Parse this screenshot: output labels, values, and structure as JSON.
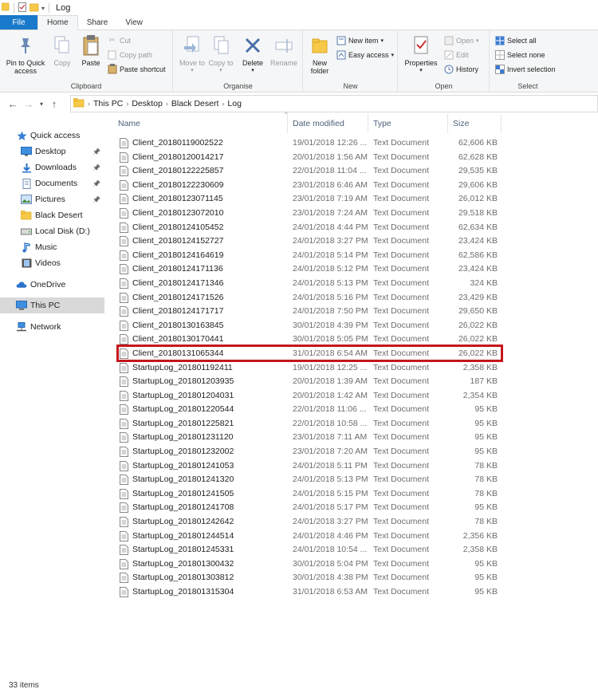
{
  "window": {
    "title": "Log"
  },
  "tabs": [
    "File",
    "Home",
    "Share",
    "View"
  ],
  "ribbon": {
    "clipboard": {
      "label": "Clipboard",
      "pin": "Pin to Quick access",
      "copy": "Copy",
      "paste": "Paste",
      "cut": "Cut",
      "copy_path": "Copy path",
      "paste_shortcut": "Paste shortcut"
    },
    "organise": {
      "label": "Organise",
      "move_to": "Move to",
      "copy_to": "Copy to",
      "delete": "Delete",
      "rename": "Rename"
    },
    "new": {
      "label": "New",
      "new_folder": "New folder",
      "new_item": "New item",
      "easy_access": "Easy access"
    },
    "open": {
      "label": "Open",
      "properties": "Properties",
      "open": "Open",
      "edit": "Edit",
      "history": "History"
    },
    "select": {
      "label": "Select",
      "select_all": "Select all",
      "select_none": "Select none",
      "invert": "Invert selection"
    }
  },
  "breadcrumb": [
    "This PC",
    "Desktop",
    "Black Desert",
    "Log"
  ],
  "nav": [
    {
      "label": "Quick access",
      "icon": "star-icon",
      "pinned": false,
      "selected": false
    },
    {
      "label": "Desktop",
      "icon": "desktop-icon",
      "pinned": true,
      "selected": false
    },
    {
      "label": "Downloads",
      "icon": "download-icon",
      "pinned": true,
      "selected": false
    },
    {
      "label": "Documents",
      "icon": "documents-icon",
      "pinned": true,
      "selected": false
    },
    {
      "label": "Pictures",
      "icon": "pictures-icon",
      "pinned": true,
      "selected": false
    },
    {
      "label": "Black Desert",
      "icon": "folder-icon",
      "pinned": false,
      "selected": false
    },
    {
      "label": "Local Disk (D:)",
      "icon": "drive-icon",
      "pinned": false,
      "selected": false
    },
    {
      "label": "Music",
      "icon": "music-icon",
      "pinned": false,
      "selected": false
    },
    {
      "label": "Videos",
      "icon": "videos-icon",
      "pinned": false,
      "selected": false
    },
    {
      "label": "OneDrive",
      "icon": "cloud-icon",
      "pinned": false,
      "selected": false
    },
    {
      "label": "This PC",
      "icon": "computer-icon",
      "pinned": false,
      "selected": true
    },
    {
      "label": "Network",
      "icon": "network-icon",
      "pinned": false,
      "selected": false
    }
  ],
  "columns": {
    "name": "Name",
    "date": "Date modified",
    "type": "Type",
    "size": "Size"
  },
  "files": [
    [
      "Client_20180119002522",
      "19/01/2018 12:26 ...",
      "Text Document",
      "62,606 KB"
    ],
    [
      "Client_20180120014217",
      "20/01/2018 1:56 AM",
      "Text Document",
      "62,628 KB"
    ],
    [
      "Client_20180122225857",
      "22/01/2018 11:04 ...",
      "Text Document",
      "29,535 KB"
    ],
    [
      "Client_20180122230609",
      "23/01/2018 6:46 AM",
      "Text Document",
      "29,606 KB"
    ],
    [
      "Client_20180123071145",
      "23/01/2018 7:19 AM",
      "Text Document",
      "26,012 KB"
    ],
    [
      "Client_20180123072010",
      "23/01/2018 7:24 AM",
      "Text Document",
      "29,518 KB"
    ],
    [
      "Client_20180124105452",
      "24/01/2018 4:44 PM",
      "Text Document",
      "62,634 KB"
    ],
    [
      "Client_20180124152727",
      "24/01/2018 3:27 PM",
      "Text Document",
      "23,424 KB"
    ],
    [
      "Client_20180124164619",
      "24/01/2018 5:14 PM",
      "Text Document",
      "62,586 KB"
    ],
    [
      "Client_20180124171136",
      "24/01/2018 5:12 PM",
      "Text Document",
      "23,424 KB"
    ],
    [
      "Client_20180124171346",
      "24/01/2018 5:13 PM",
      "Text Document",
      "324 KB"
    ],
    [
      "Client_20180124171526",
      "24/01/2018 5:16 PM",
      "Text Document",
      "23,429 KB"
    ],
    [
      "Client_20180124171717",
      "24/01/2018 7:50 PM",
      "Text Document",
      "29,650 KB"
    ],
    [
      "Client_20180130163845",
      "30/01/2018 4:39 PM",
      "Text Document",
      "26,022 KB"
    ],
    [
      "Client_20180130170441",
      "30/01/2018 5:05 PM",
      "Text Document",
      "26,022 KB"
    ],
    [
      "Client_20180131065344",
      "31/01/2018 6:54 AM",
      "Text Document",
      "26,022 KB"
    ],
    [
      "StartupLog_201801192411",
      "19/01/2018 12:25 ...",
      "Text Document",
      "2,358 KB"
    ],
    [
      "StartupLog_201801203935",
      "20/01/2018 1:39 AM",
      "Text Document",
      "187 KB"
    ],
    [
      "StartupLog_201801204031",
      "20/01/2018 1:42 AM",
      "Text Document",
      "2,354 KB"
    ],
    [
      "StartupLog_201801220544",
      "22/01/2018 11:06 ...",
      "Text Document",
      "95 KB"
    ],
    [
      "StartupLog_201801225821",
      "22/01/2018 10:58 ...",
      "Text Document",
      "95 KB"
    ],
    [
      "StartupLog_201801231120",
      "23/01/2018 7:11 AM",
      "Text Document",
      "95 KB"
    ],
    [
      "StartupLog_201801232002",
      "23/01/2018 7:20 AM",
      "Text Document",
      "95 KB"
    ],
    [
      "StartupLog_201801241053",
      "24/01/2018 5:11 PM",
      "Text Document",
      "78 KB"
    ],
    [
      "StartupLog_201801241320",
      "24/01/2018 5:13 PM",
      "Text Document",
      "78 KB"
    ],
    [
      "StartupLog_201801241505",
      "24/01/2018 5:15 PM",
      "Text Document",
      "78 KB"
    ],
    [
      "StartupLog_201801241708",
      "24/01/2018 5:17 PM",
      "Text Document",
      "95 KB"
    ],
    [
      "StartupLog_201801242642",
      "24/01/2018 3:27 PM",
      "Text Document",
      "78 KB"
    ],
    [
      "StartupLog_201801244514",
      "24/01/2018 4:46 PM",
      "Text Document",
      "2,356 KB"
    ],
    [
      "StartupLog_201801245331",
      "24/01/2018 10:54 ...",
      "Text Document",
      "2,358 KB"
    ],
    [
      "StartupLog_201801300432",
      "30/01/2018 5:04 PM",
      "Text Document",
      "95 KB"
    ],
    [
      "StartupLog_201801303812",
      "30/01/2018 4:38 PM",
      "Text Document",
      "95 KB"
    ],
    [
      "StartupLog_201801315304",
      "31/01/2018 6:53 AM",
      "Text Document",
      "95 KB"
    ]
  ],
  "highlighted_file": "Client_20180131065344",
  "highlight_color": "#c5161c",
  "accent_color": "#1979ca",
  "status": {
    "item_count": "33 items"
  }
}
